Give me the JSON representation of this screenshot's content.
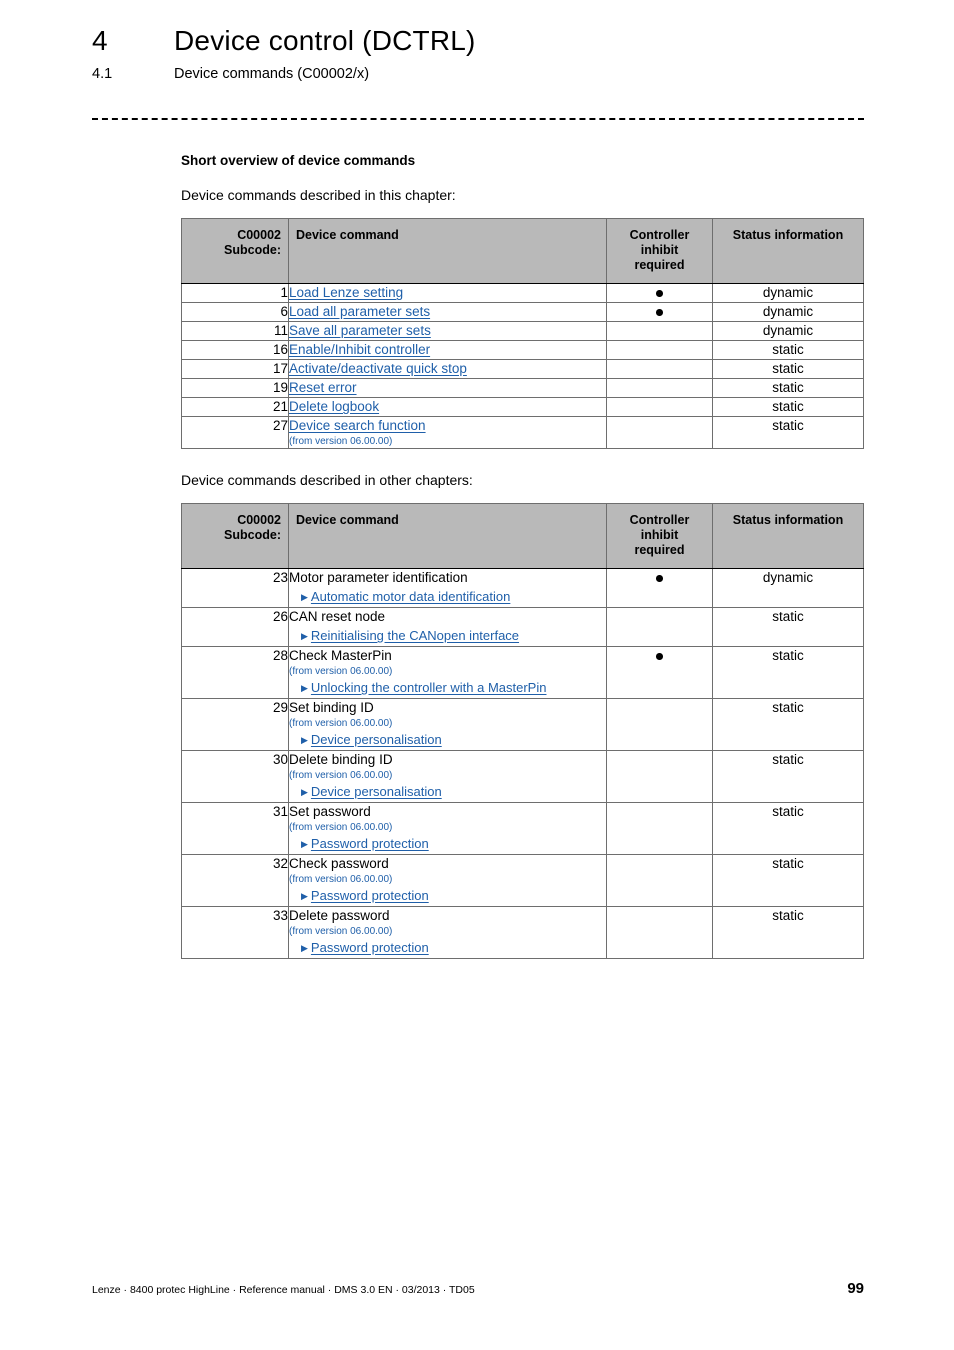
{
  "header": {
    "chapter_number": "4",
    "chapter_title": "Device control (DCTRL)",
    "section_number": "4.1",
    "section_title": "Device commands (C00002/x)"
  },
  "body": {
    "subheading": "Short overview of device commands",
    "intro_table1": "Device commands described in this chapter:",
    "intro_table2": "Device commands described in other chapters:"
  },
  "table_columns": {
    "subcode_line1": "C00002",
    "subcode_line2": "Subcode:",
    "command": "Device command",
    "inhibit_line1": "Controller",
    "inhibit_line2": "inhibit",
    "inhibit_line3": "required",
    "status": "Status information"
  },
  "table1": {
    "rows": [
      {
        "subcode": "1",
        "command": "Load Lenze setting",
        "is_link": true,
        "version": "",
        "subref": "",
        "inhibit": "●",
        "status": "dynamic"
      },
      {
        "subcode": "6",
        "command": "Load all parameter sets",
        "is_link": true,
        "version": "",
        "subref": "",
        "inhibit": "●",
        "status": "dynamic"
      },
      {
        "subcode": "11",
        "command": "Save all parameter sets",
        "is_link": true,
        "version": "",
        "subref": "",
        "inhibit": "",
        "status": "dynamic"
      },
      {
        "subcode": "16",
        "command": "Enable/Inhibit controller",
        "is_link": true,
        "version": "",
        "subref": "",
        "inhibit": "",
        "status": "static"
      },
      {
        "subcode": "17",
        "command": "Activate/deactivate quick stop",
        "is_link": true,
        "version": "",
        "subref": "",
        "inhibit": "",
        "status": "static"
      },
      {
        "subcode": "19",
        "command": "Reset error",
        "is_link": true,
        "version": "",
        "subref": "",
        "inhibit": "",
        "status": "static"
      },
      {
        "subcode": "21",
        "command": "Delete logbook",
        "is_link": true,
        "version": "",
        "subref": "",
        "inhibit": "",
        "status": "static"
      },
      {
        "subcode": "27",
        "command": "Device search function",
        "is_link": true,
        "version": "(from version 06.00.00)",
        "subref": "",
        "inhibit": "",
        "status": "static"
      }
    ]
  },
  "table2": {
    "rows": [
      {
        "subcode": "23",
        "command": "Motor parameter identification",
        "is_link": false,
        "version": "",
        "subref": "Automatic motor data identification",
        "inhibit": "●",
        "status": "dynamic"
      },
      {
        "subcode": "26",
        "command": "CAN reset node",
        "is_link": false,
        "version": "",
        "subref": "Reinitialising the CANopen interface",
        "inhibit": "",
        "status": "static"
      },
      {
        "subcode": "28",
        "command": "Check MasterPin",
        "is_link": false,
        "version": "(from version 06.00.00)",
        "subref": "Unlocking the controller with a MasterPin",
        "inhibit": "●",
        "status": "static"
      },
      {
        "subcode": "29",
        "command": "Set binding ID",
        "is_link": false,
        "version": "(from version 06.00.00)",
        "subref": "Device personalisation",
        "inhibit": "",
        "status": "static"
      },
      {
        "subcode": "30",
        "command": "Delete binding ID",
        "is_link": false,
        "version": "(from version 06.00.00)",
        "subref": "Device personalisation",
        "inhibit": "",
        "status": "static"
      },
      {
        "subcode": "31",
        "command": "Set password",
        "is_link": false,
        "version": "(from version 06.00.00)",
        "subref": "Password protection",
        "inhibit": "",
        "status": "static"
      },
      {
        "subcode": "32",
        "command": "Check password",
        "is_link": false,
        "version": "(from version 06.00.00)",
        "subref": "Password protection",
        "inhibit": "",
        "status": "static"
      },
      {
        "subcode": "33",
        "command": "Delete password",
        "is_link": false,
        "version": "(from version 06.00.00)",
        "subref": "Password protection",
        "inhibit": "",
        "status": "static"
      }
    ]
  },
  "footer": {
    "text": "Lenze · 8400 protec HighLine · Reference manual · DMS 3.0 EN · 03/2013 · TD05",
    "page_number": "99"
  },
  "colors": {
    "link": "#1f5fa9",
    "table_header_bg": "#b9b9b9",
    "border": "#6e6e6e"
  }
}
